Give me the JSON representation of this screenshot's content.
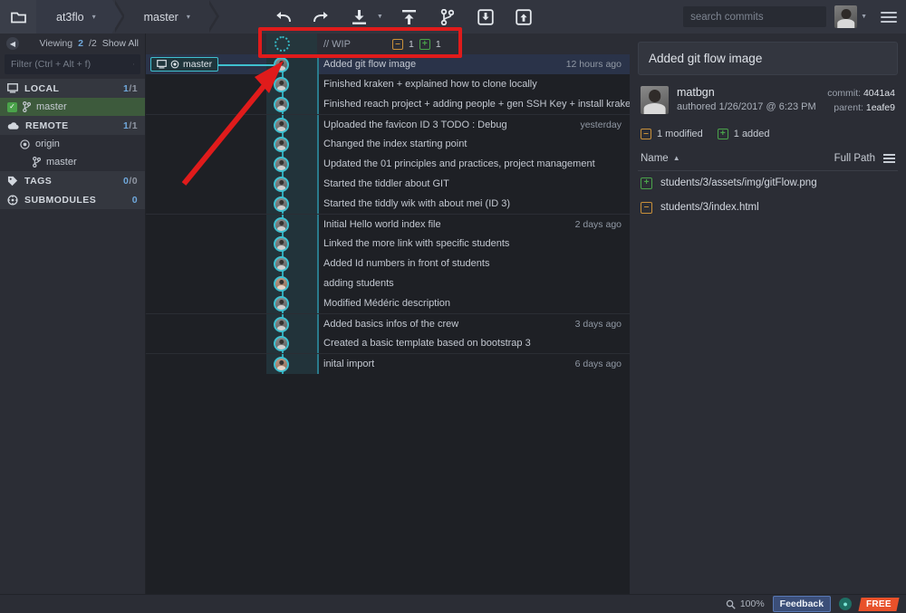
{
  "topbar": {
    "folder_icon": "folder-icon",
    "breadcrumbs": [
      {
        "label": "at3flo",
        "caret": "▾"
      },
      {
        "label": "master",
        "caret": "▾"
      }
    ],
    "tools": [
      {
        "name": "undo-button",
        "icon": "undo-icon"
      },
      {
        "name": "redo-button",
        "icon": "redo-icon"
      },
      {
        "name": "pull-button",
        "icon": "pull-down-icon"
      },
      {
        "name": "pull-dropdown",
        "icon": "chevron-down-icon"
      },
      {
        "name": "push-button",
        "icon": "push-up-icon"
      },
      {
        "name": "branch-button",
        "icon": "branch-icon"
      },
      {
        "name": "stash-button",
        "icon": "stash-icon"
      },
      {
        "name": "pop-stash-button",
        "icon": "pop-stash-icon"
      }
    ],
    "search": {
      "value": "",
      "placeholder": "search commits",
      "icon": "search-icon"
    },
    "avatar": "user-avatar",
    "menu_icon": "hamburger-menu-icon"
  },
  "sidebar": {
    "back_icon": "◀",
    "viewing_label": "Viewing",
    "viewing_current": "2",
    "viewing_total": "/2",
    "show_all": "Show All",
    "filter": {
      "value": "",
      "placeholder": "Filter (Ctrl + Alt + f)"
    },
    "groups": [
      {
        "name": "LOCAL",
        "icon": "monitor-icon",
        "count_current": "1",
        "count_total": "/1",
        "items": [
          {
            "label": "master",
            "checked": true,
            "icon": "branch-icon",
            "indent": 0
          }
        ]
      },
      {
        "name": "REMOTE",
        "icon": "cloud-icon",
        "count_current": "1",
        "count_total": "/1",
        "items": [
          {
            "label": "origin",
            "checked": false,
            "icon": "remote-icon",
            "indent": 1
          },
          {
            "label": "master",
            "checked": false,
            "icon": "branch-icon",
            "indent": 2
          }
        ]
      },
      {
        "name": "TAGS",
        "icon": "tag-icon",
        "count_current": "0",
        "count_total": "/0",
        "items": []
      },
      {
        "name": "SUBMODULES",
        "icon": "submodule-icon",
        "count_current": "0",
        "count_total": "",
        "items": []
      }
    ]
  },
  "commits": {
    "wip": {
      "message": "// WIP",
      "modified_count": "1",
      "added_count": "1",
      "modified_glyph": "–",
      "added_glyph": "+"
    },
    "branch_tag": {
      "label": "master",
      "monitor_icon": "monitor-icon",
      "remote_icon": "remote-icon"
    },
    "rows": [
      {
        "message": "Added git flow image",
        "time": "12 hours ago",
        "selected": true,
        "separator": false,
        "avatar": "cool"
      },
      {
        "message": "Finished kraken + explained how to clone locally",
        "time": "",
        "selected": false,
        "separator": false,
        "avatar": "cool"
      },
      {
        "message": "Finished reach project + adding people + gen SSH Key + install kraken",
        "time": "",
        "selected": false,
        "separator": false,
        "avatar": "cool"
      },
      {
        "message": "Uploaded the favicon ID 3 TODO : Debug",
        "time": "yesterday",
        "selected": false,
        "separator": true,
        "avatar": "cool"
      },
      {
        "message": "Changed the index starting point",
        "time": "",
        "selected": false,
        "separator": false,
        "avatar": "cool"
      },
      {
        "message": "Updated the 01 principles and practices, project management",
        "time": "",
        "selected": false,
        "separator": false,
        "avatar": "cool"
      },
      {
        "message": "Started the tiddler about GIT",
        "time": "",
        "selected": false,
        "separator": false,
        "avatar": "cool"
      },
      {
        "message": "Started the tiddly wik with about mei (ID 3)",
        "time": "",
        "selected": false,
        "separator": false,
        "avatar": "cool"
      },
      {
        "message": "Initial Hello world index file",
        "time": "2 days ago",
        "selected": false,
        "separator": true,
        "avatar": "cool"
      },
      {
        "message": "Linked the more link with specific students",
        "time": "",
        "selected": false,
        "separator": false,
        "avatar": "cool"
      },
      {
        "message": "Added Id numbers in front of students",
        "time": "",
        "selected": false,
        "separator": false,
        "avatar": "cool"
      },
      {
        "message": "adding students",
        "time": "",
        "selected": false,
        "separator": false,
        "avatar": "warm"
      },
      {
        "message": "Modified Médéric description",
        "time": "",
        "selected": false,
        "separator": false,
        "avatar": "cool"
      },
      {
        "message": "Added basics infos of the crew",
        "time": "3 days ago",
        "selected": false,
        "separator": true,
        "avatar": "cool"
      },
      {
        "message": "Created a basic template based on bootstrap 3",
        "time": "",
        "selected": false,
        "separator": false,
        "avatar": "cool"
      },
      {
        "message": "inital import",
        "time": "6 days ago",
        "selected": false,
        "separator": true,
        "avatar": "warm"
      }
    ]
  },
  "detail": {
    "title": "Added git flow image",
    "author": "matbgn",
    "authored": "authored 1/26/2017 @ 6:23 PM",
    "commit_label": "commit:",
    "commit_hash": "4041a4",
    "parent_label": "parent:",
    "parent_hash": "1eafe9",
    "modified_stat": "1 modified",
    "added_stat": "1 added",
    "modified_glyph": "–",
    "added_glyph": "+",
    "col_name": "Name",
    "sort_arrow": "▲",
    "col_fullpath": "Full Path",
    "list_icon": "list-view-icon",
    "files": [
      {
        "path": "students/3/assets/img/gitFlow.png",
        "status": "added",
        "glyph": "+"
      },
      {
        "path": "students/3/index.html",
        "status": "modified",
        "glyph": "–"
      }
    ]
  },
  "statusbar": {
    "zoom_icon": "magnifier-icon",
    "zoom_level": "100%",
    "feedback": "Feedback",
    "globe_icon": "globe-icon",
    "free_badge": "FREE"
  }
}
